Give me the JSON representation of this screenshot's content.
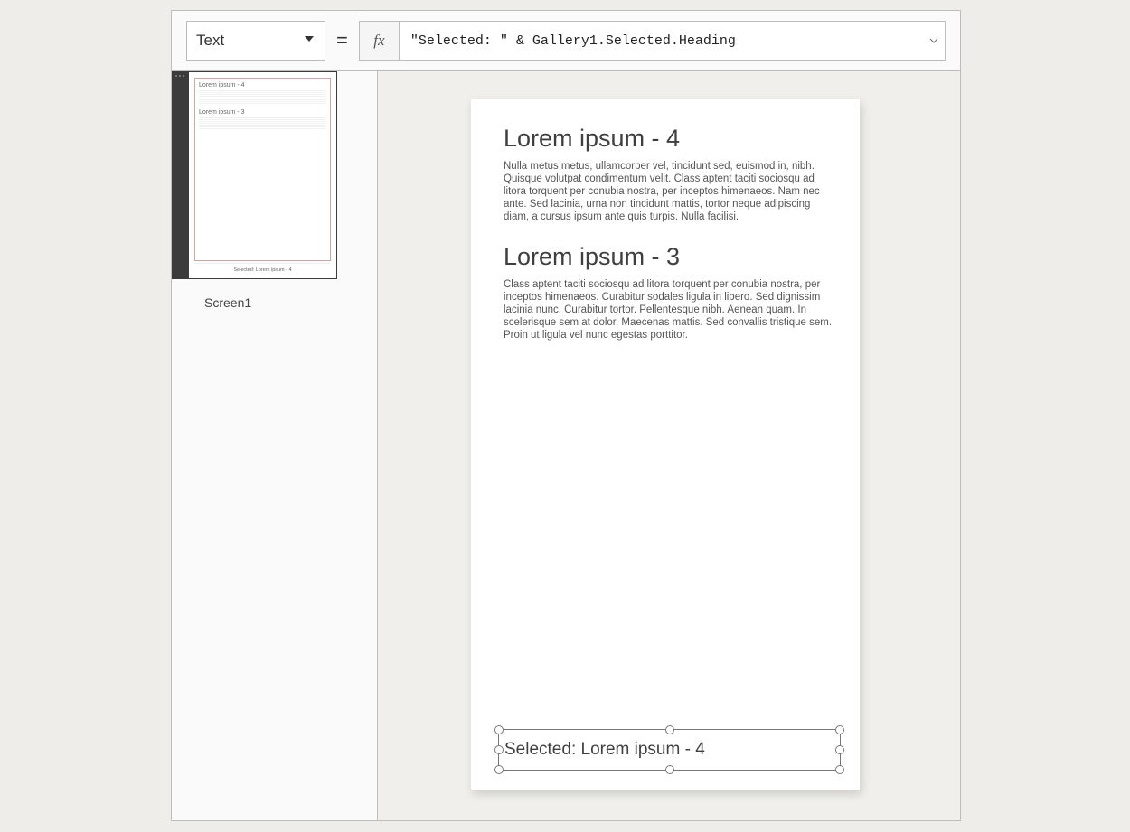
{
  "formula_bar": {
    "property_label": "Text",
    "fx_label": "fx",
    "formula": "\"Selected: \" & Gallery1.Selected.Heading"
  },
  "screens": {
    "current_label": "Screen1",
    "thumb": {
      "h1": "Lorem ipsum - 4",
      "h2": "Lorem ipsum - 3",
      "selected_bar": "Selected: Lorem ipsum - 4"
    }
  },
  "canvas": {
    "gallery_items": [
      {
        "heading": "Lorem ipsum - 4",
        "body": "Nulla metus metus, ullamcorper vel, tincidunt sed, euismod in, nibh. Quisque volutpat condimentum velit. Class aptent taciti sociosqu ad litora torquent per conubia nostra, per inceptos himenaeos. Nam nec ante. Sed lacinia, urna non tincidunt mattis, tortor neque adipiscing diam, a cursus ipsum ante quis turpis. Nulla facilisi."
      },
      {
        "heading": "Lorem ipsum - 3",
        "body": "Class aptent taciti sociosqu ad litora torquent per conubia nostra, per inceptos himenaeos. Curabitur sodales ligula in libero. Sed dignissim lacinia nunc. Curabitur tortor. Pellentesque nibh. Aenean quam. In scelerisque sem at dolor. Maecenas mattis. Sed convallis tristique sem. Proin ut ligula vel nunc egestas porttitor."
      }
    ],
    "selected_label_text": "Selected: Lorem ipsum - 4"
  }
}
